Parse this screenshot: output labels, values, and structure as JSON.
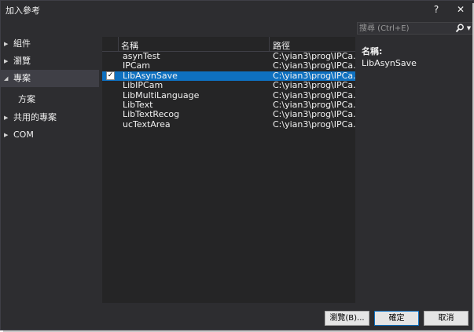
{
  "window": {
    "title": "加入參考",
    "help_glyph": "?",
    "close_glyph": "✕"
  },
  "nav": {
    "items": [
      {
        "label": "組件",
        "expanded": false,
        "active": false
      },
      {
        "label": "瀏覽",
        "expanded": false,
        "active": false
      },
      {
        "label": "專案",
        "expanded": true,
        "active": true
      },
      {
        "label": "方案",
        "sub": true,
        "active": false
      },
      {
        "label": "共用的專案",
        "expanded": false,
        "active": false
      },
      {
        "label": "COM",
        "expanded": false,
        "active": false
      }
    ]
  },
  "list": {
    "columns": {
      "name": "名稱",
      "path": "路徑"
    },
    "rows": [
      {
        "name": "asynTest",
        "path": "C:\\yian3\\prog\\IPCa...",
        "checked": false,
        "selected": false
      },
      {
        "name": "IPCam",
        "path": "C:\\yian3\\prog\\IPCa...",
        "checked": false,
        "selected": false
      },
      {
        "name": "LibAsynSave",
        "path": "C:\\yian3\\prog\\IPCa...",
        "checked": true,
        "selected": true
      },
      {
        "name": "LibIPCam",
        "path": "C:\\yian3\\prog\\IPCa...",
        "checked": false,
        "selected": false
      },
      {
        "name": "LibMultiLanguage",
        "path": "C:\\yian3\\prog\\IPCa...",
        "checked": false,
        "selected": false
      },
      {
        "name": "LibText",
        "path": "C:\\yian3\\prog\\IPCa...",
        "checked": false,
        "selected": false
      },
      {
        "name": "LibTextRecog",
        "path": "C:\\yian3\\prog\\IPCa...",
        "checked": false,
        "selected": false
      },
      {
        "name": "ucTextArea",
        "path": "C:\\yian3\\prog\\IPCa...",
        "checked": false,
        "selected": false
      }
    ]
  },
  "search": {
    "placeholder": "搜尋 (Ctrl+E)",
    "icon": "search-icon"
  },
  "details": {
    "label": "名稱:",
    "value": "LibAsynSave"
  },
  "buttons": {
    "browse": "瀏覽(B)...",
    "ok": "確定",
    "cancel": "取消"
  },
  "colors": {
    "background": "#2d2d30",
    "list_background": "#252526",
    "selection": "#0e70c0",
    "nav_active": "#3f3f46"
  }
}
